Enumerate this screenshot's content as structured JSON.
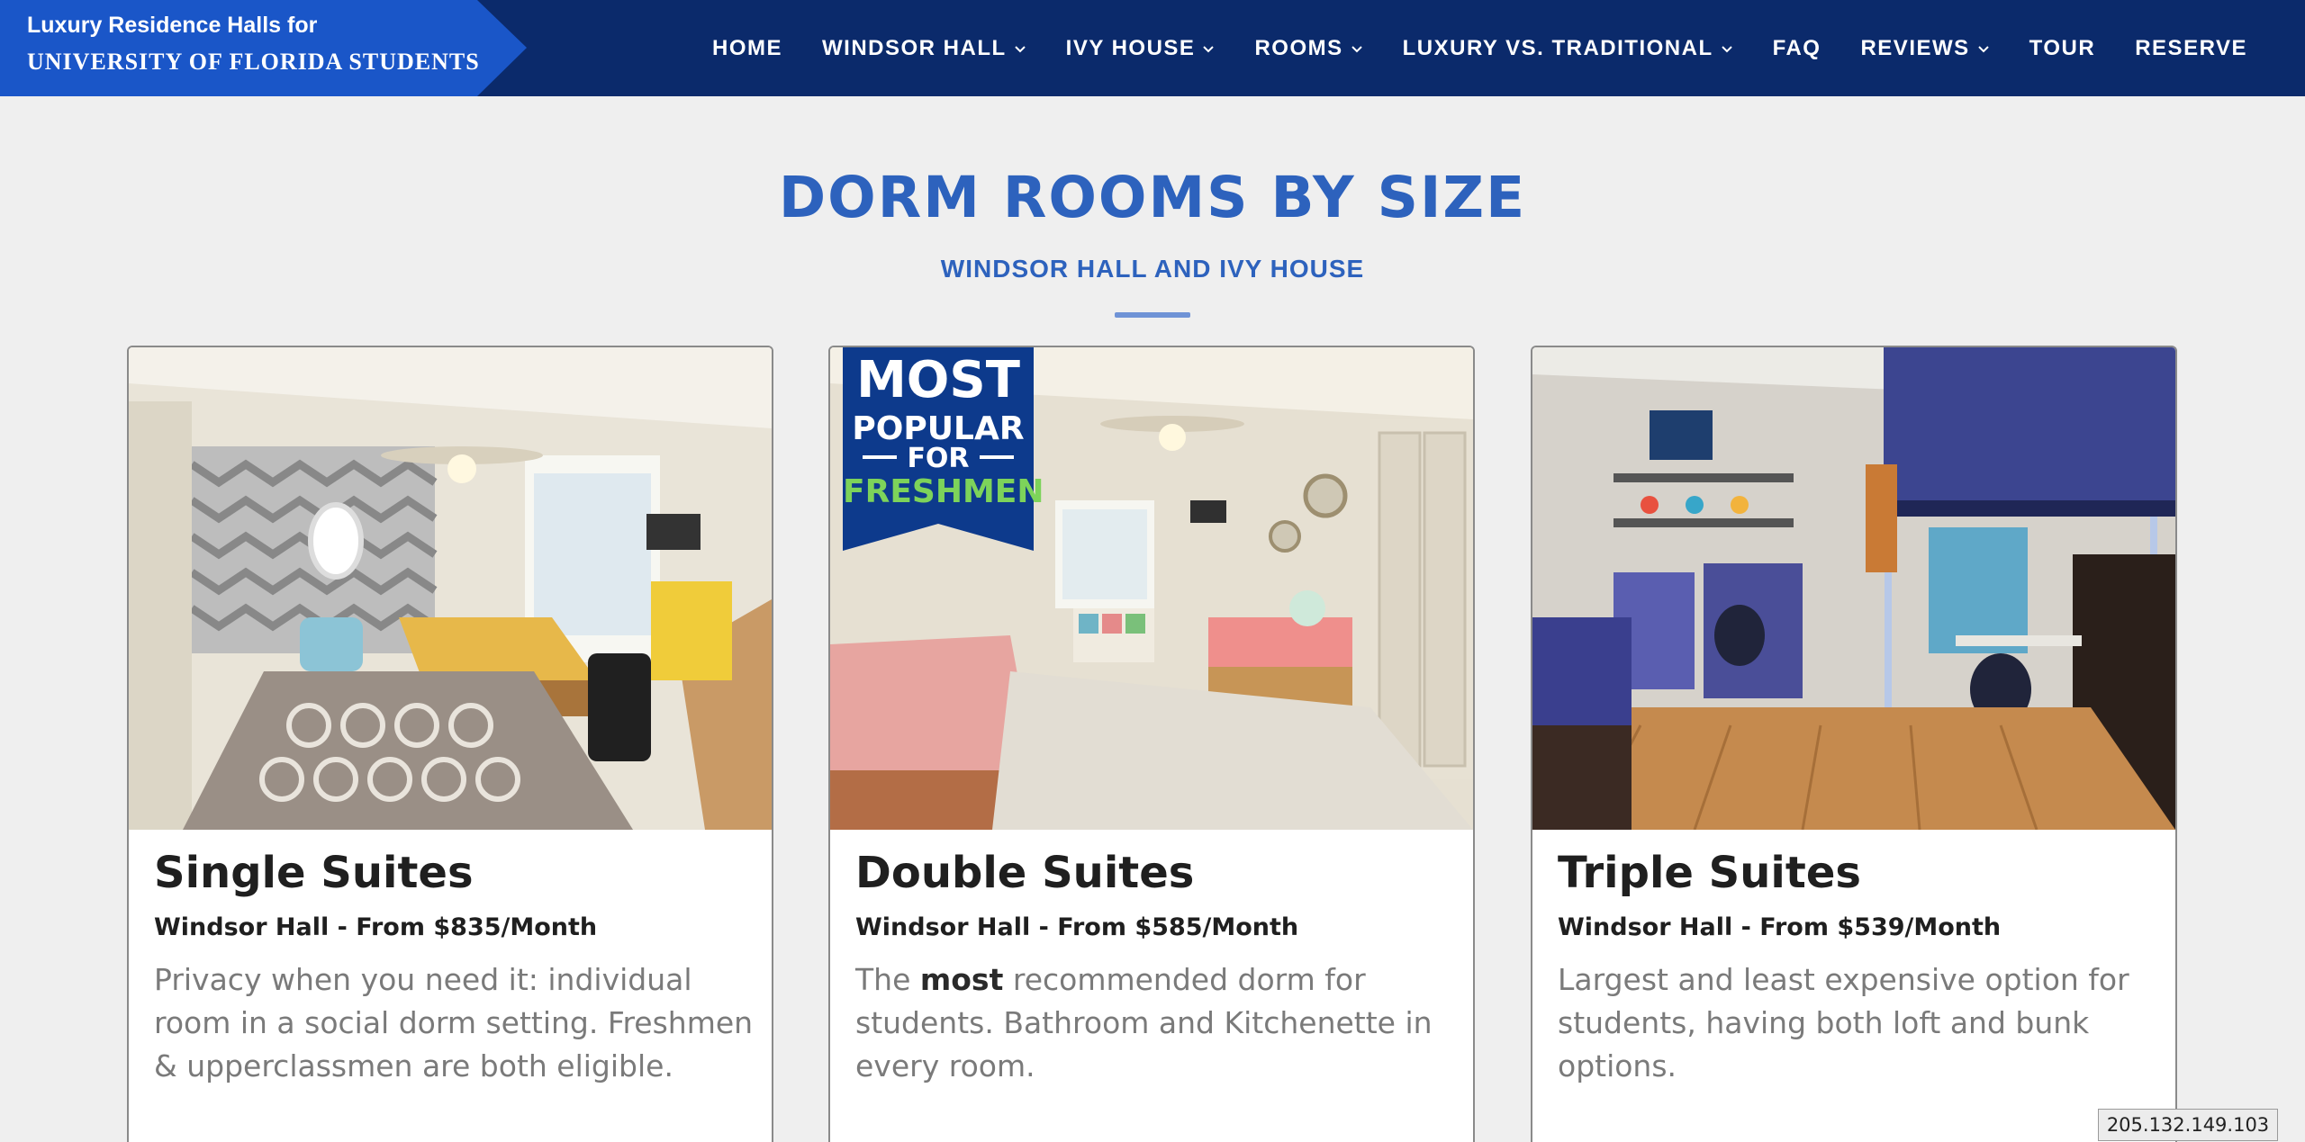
{
  "brand": {
    "line1": "Luxury Residence Halls for",
    "line2": "UNIVERSITY OF FLORIDA STUDENTS"
  },
  "nav": [
    {
      "label": "HOME",
      "dropdown": false
    },
    {
      "label": "WINDSOR HALL",
      "dropdown": true
    },
    {
      "label": "IVY HOUSE",
      "dropdown": true
    },
    {
      "label": "ROOMS",
      "dropdown": true
    },
    {
      "label": "LUXURY VS. TRADITIONAL",
      "dropdown": true
    },
    {
      "label": "FAQ",
      "dropdown": false
    },
    {
      "label": "REVIEWS",
      "dropdown": true
    },
    {
      "label": "TOUR",
      "dropdown": false
    },
    {
      "label": "RESERVE",
      "dropdown": false
    }
  ],
  "heading": {
    "title": "DORM ROOMS BY SIZE",
    "subtitle": "WINDSOR HALL AND IVY HOUSE"
  },
  "cards": [
    {
      "title": "Single Suites",
      "price": "Windsor Hall - From $835/Month",
      "description": "Privacy when you need it: individual room in a social dorm setting. Freshmen & upperclassmen are both eligible."
    },
    {
      "title": "Double Suites",
      "price": "Windsor Hall - From $585/Month",
      "desc_before": "The ",
      "desc_bold": "most",
      "desc_after": " recommended dorm for students. Bathroom and Kitchenette in every room.",
      "badge": {
        "line1": "MOST",
        "line2": "POPULAR",
        "line3": "FOR",
        "line4": "FRESHMEN"
      }
    },
    {
      "title": "Triple Suites",
      "price": "Windsor Hall - From $539/Month",
      "description": "Largest and least expensive option for students, having both loft and bunk options."
    }
  ],
  "ip_address": "205.132.149.103",
  "colors": {
    "header_bg": "#0b2a6b",
    "brand_bg": "#1a56c8",
    "heading": "#2d62bd",
    "badge_bg": "#0d3a8c",
    "badge_accent": "#7dd35a"
  }
}
